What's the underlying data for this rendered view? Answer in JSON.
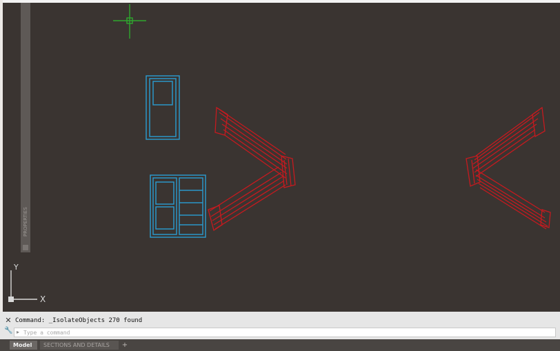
{
  "colors": {
    "canvas": "#3a3431",
    "door": "#2b97c9",
    "stairs": "#c61a1f",
    "crosshair": "#2ea82e",
    "ucs": "#d9d9d9"
  },
  "palette": {
    "label": "PROPERTIES"
  },
  "ucs": {
    "x_label": "X",
    "y_label": "Y"
  },
  "command": {
    "history": "Command: _IsolateObjects 270 found",
    "placeholder": "Type a command",
    "close_icon": "close-icon",
    "grip_icon": "wrench-icon"
  },
  "tabs": {
    "model": "Model",
    "layout": "SECTIONS AND DETAILS",
    "add": "+"
  }
}
